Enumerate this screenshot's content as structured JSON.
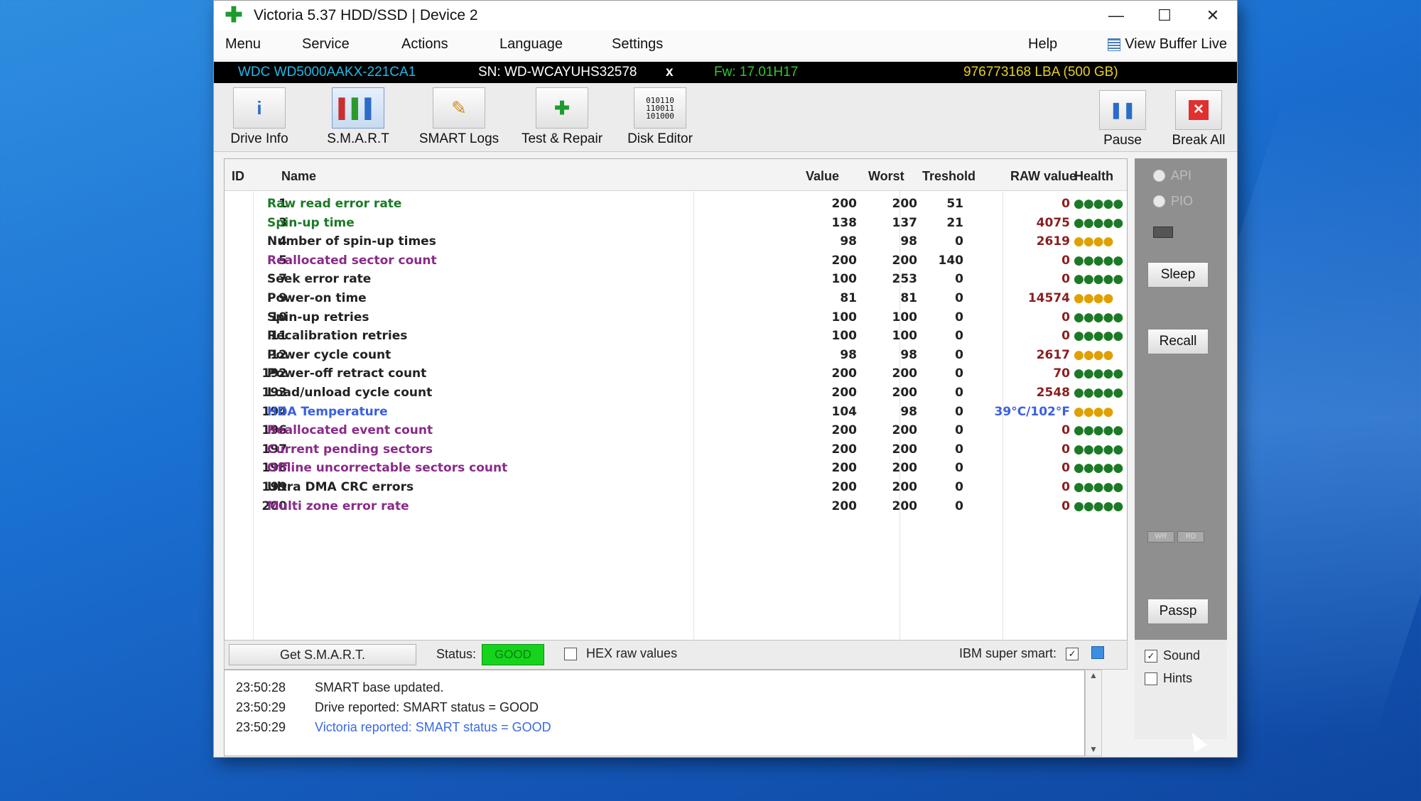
{
  "window": {
    "title": "Victoria 5.37 HDD/SSD | Device 2",
    "controls": {
      "minimize": "—",
      "maximize": "☐",
      "close": "✕"
    }
  },
  "menu": {
    "items": [
      "Menu",
      "Service",
      "Actions",
      "Language",
      "Settings",
      "Help"
    ],
    "view_buffer": "View Buffer Live"
  },
  "drive": {
    "model": "WDC WD5000AAKX-221CA1",
    "serial": "SN: WD-WCAYUHS32578",
    "close_x": "x",
    "firmware": "Fw: 17.01H17",
    "capacity": "976773168 LBA (500 GB)"
  },
  "toolbar": {
    "tabs": [
      "Drive Info",
      "S.M.A.R.T",
      "SMART Logs",
      "Test & Repair",
      "Disk Editor"
    ],
    "active_tab": "S.M.A.R.T",
    "pause": "Pause",
    "break_all": "Break All"
  },
  "table": {
    "headers": {
      "id": "ID",
      "name": "Name",
      "value": "Value",
      "worst": "Worst",
      "threshold": "Treshold",
      "raw": "RAW value",
      "health": "Health"
    },
    "rows": [
      {
        "id": "1",
        "name": "Raw read error rate",
        "value": "200",
        "worst": "200",
        "thr": "51",
        "raw": "0",
        "health": "●●●●●",
        "name_color": "#1c7a26",
        "health_color": "#1c7a26"
      },
      {
        "id": "3",
        "name": "Spin-up time",
        "value": "138",
        "worst": "137",
        "thr": "21",
        "raw": "4075",
        "health": "●●●●●",
        "name_color": "#1c7a26",
        "health_color": "#1c7a26"
      },
      {
        "id": "4",
        "name": "Number of spin-up times",
        "value": "98",
        "worst": "98",
        "thr": "0",
        "raw": "2619",
        "health": "●●●●",
        "name_color": "#222222",
        "health_color": "#e0a000"
      },
      {
        "id": "5",
        "name": "Reallocated sector count",
        "value": "200",
        "worst": "200",
        "thr": "140",
        "raw": "0",
        "health": "●●●●●",
        "name_color": "#8a2a8a",
        "health_color": "#1c7a26"
      },
      {
        "id": "7",
        "name": "Seek error rate",
        "value": "100",
        "worst": "253",
        "thr": "0",
        "raw": "0",
        "health": "●●●●●",
        "name_color": "#222222",
        "health_color": "#1c7a26"
      },
      {
        "id": "9",
        "name": "Power-on time",
        "value": "81",
        "worst": "81",
        "thr": "0",
        "raw": "14574",
        "health": "●●●●",
        "name_color": "#222222",
        "health_color": "#e0a000"
      },
      {
        "id": "10",
        "name": "Spin-up retries",
        "value": "100",
        "worst": "100",
        "thr": "0",
        "raw": "0",
        "health": "●●●●●",
        "name_color": "#222222",
        "health_color": "#1c7a26"
      },
      {
        "id": "11",
        "name": "Recalibration retries",
        "value": "100",
        "worst": "100",
        "thr": "0",
        "raw": "0",
        "health": "●●●●●",
        "name_color": "#222222",
        "health_color": "#1c7a26"
      },
      {
        "id": "12",
        "name": "Power cycle count",
        "value": "98",
        "worst": "98",
        "thr": "0",
        "raw": "2617",
        "health": "●●●●",
        "name_color": "#222222",
        "health_color": "#e0a000"
      },
      {
        "id": "192",
        "name": "Power-off retract count",
        "value": "200",
        "worst": "200",
        "thr": "0",
        "raw": "70",
        "health": "●●●●●",
        "name_color": "#222222",
        "health_color": "#1c7a26"
      },
      {
        "id": "193",
        "name": "Load/unload cycle count",
        "value": "200",
        "worst": "200",
        "thr": "0",
        "raw": "2548",
        "health": "●●●●●",
        "name_color": "#222222",
        "health_color": "#1c7a26"
      },
      {
        "id": "194",
        "name": "HDA Temperature",
        "value": "104",
        "worst": "98",
        "thr": "0",
        "raw": "39°C/102°F",
        "health": "●●●●",
        "name_color": "#3a5fe0",
        "health_color": "#e0a000",
        "raw_color": "#3a5fe0"
      },
      {
        "id": "196",
        "name": "Reallocated event count",
        "value": "200",
        "worst": "200",
        "thr": "0",
        "raw": "0",
        "health": "●●●●●",
        "name_color": "#8a2a8a",
        "health_color": "#1c7a26"
      },
      {
        "id": "197",
        "name": "Current pending sectors",
        "value": "200",
        "worst": "200",
        "thr": "0",
        "raw": "0",
        "health": "●●●●●",
        "name_color": "#8a2a8a",
        "health_color": "#1c7a26"
      },
      {
        "id": "198",
        "name": "Offline uncorrectable sectors count",
        "value": "200",
        "worst": "200",
        "thr": "0",
        "raw": "0",
        "health": "●●●●●",
        "name_color": "#8a2a8a",
        "health_color": "#1c7a26"
      },
      {
        "id": "199",
        "name": "Ultra DMA CRC errors",
        "value": "200",
        "worst": "200",
        "thr": "0",
        "raw": "0",
        "health": "●●●●●",
        "name_color": "#222222",
        "health_color": "#1c7a26"
      },
      {
        "id": "200",
        "name": "Multi zone error rate",
        "value": "200",
        "worst": "200",
        "thr": "0",
        "raw": "0",
        "health": "●●●●●",
        "name_color": "#8a2a8a",
        "health_color": "#1c7a26"
      }
    ]
  },
  "statusbar": {
    "get_smart": "Get S.M.A.R.T.",
    "status_label": "Status:",
    "status_value": "GOOD",
    "hex_raw": "HEX raw values",
    "ibm_super_smart": "IBM super smart:"
  },
  "log": {
    "lines": [
      {
        "time": "23:50:28",
        "text": "SMART base updated.",
        "color": "#222222"
      },
      {
        "time": "23:50:29",
        "text": "Drive reported: SMART status = GOOD",
        "color": "#222222"
      },
      {
        "time": "23:50:29",
        "text": "Victoria reported: SMART status = GOOD",
        "color": "#3a6ae0"
      }
    ]
  },
  "side": {
    "api": "API",
    "pio": "PIO",
    "sleep": "Sleep",
    "recall": "Recall",
    "wr": "WR",
    "rd": "RD",
    "passp": "Passp",
    "sound": "Sound",
    "hints": "Hints"
  }
}
